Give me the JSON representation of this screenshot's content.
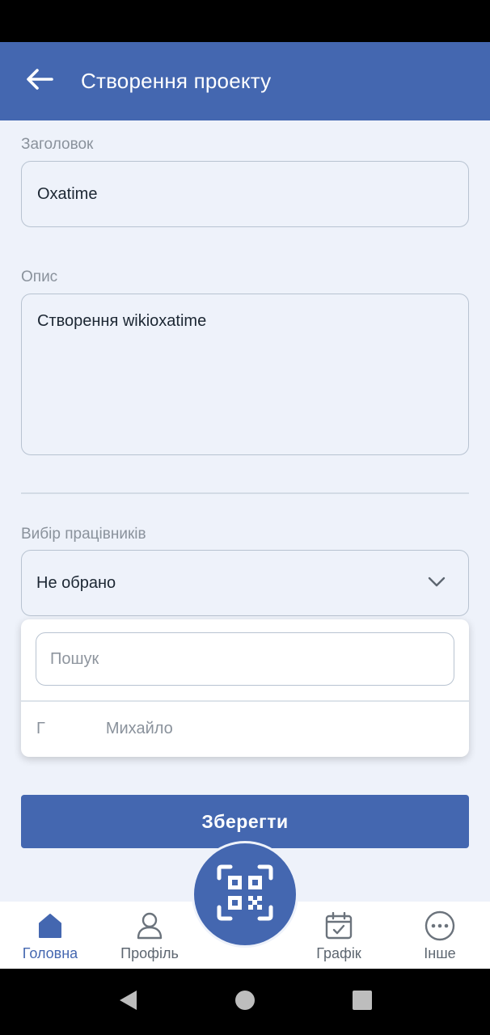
{
  "app_bar": {
    "title": "Створення проекту",
    "back_icon": "arrow-left-icon"
  },
  "form": {
    "title_label": "Заголовок",
    "title_value": "Oxatime",
    "description_label": "Опис",
    "description_value": "Створення wikioxatime",
    "employees_label": "Вибір працівників",
    "employees_selected": "Не обрано"
  },
  "dropdown": {
    "search_placeholder": "Пошук",
    "items": [
      {
        "initial": "Г",
        "name": "Михайло"
      }
    ]
  },
  "save_label": "Зберегти",
  "bottom_nav": {
    "items": [
      {
        "label": "Головна",
        "icon": "home-icon",
        "active": true
      },
      {
        "label": "Профіль",
        "icon": "user-icon",
        "active": false
      },
      {
        "label": "Графік",
        "icon": "calendar-icon",
        "active": false
      },
      {
        "label": "Інше",
        "icon": "more-icon",
        "active": false
      }
    ],
    "fab_icon": "qr-code-icon"
  },
  "colors": {
    "primary": "#4467b0",
    "background": "#eef2fa",
    "border": "#b8c3d1",
    "muted_text": "#8a929c"
  }
}
